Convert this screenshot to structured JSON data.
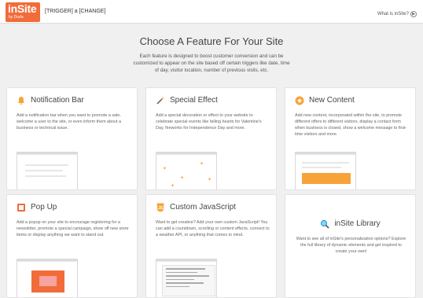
{
  "header": {
    "logo_text": "inSite",
    "logo_subtext": "by Duda",
    "trigger_text": "[TRIGGER] a [CHANGE]",
    "what_link": "What is inSite?"
  },
  "page": {
    "title": "Choose A Feature For Your Site",
    "intro": "Each feature is designed to boost customer conversion and can be customized to appear on the site based off certain triggers like date, time of day, visitor location, number of previous visits, etc."
  },
  "cards": [
    {
      "title": "Notification Bar",
      "icon": "bell-icon",
      "desc": "Add a notification bar when you want to promote a sale, welcome a user to the site, or even inform them about a business or technical issue."
    },
    {
      "title": "Special Effect",
      "icon": "magic-wand-icon",
      "desc": "Add a special decoration or effect to your website to celebrate special events like falling hearts for Valentine's Day, fireworks for Independence Day and more."
    },
    {
      "title": "New Content",
      "icon": "star-icon",
      "desc": "Add new content, incorporated within the site, to promote different offers to different visitors, display a contact form when business is closed, show a welcome message to first-time visitors and more."
    },
    {
      "title": "Pop Up",
      "icon": "popup-icon",
      "desc": "Add a popup on your site to encourage registering for a newsletter, promote a special campaign, show off new store items or display anything we want to stand out."
    },
    {
      "title": "Custom JavaScript",
      "icon": "javascript-icon",
      "desc": "Want to get creative? Add your own custom JavaScript! You can add a countdown, scrolling or content effects, connect to a weather API, or anything that comes to mind."
    },
    {
      "title": "inSite Library",
      "icon": "search-icon",
      "desc": "Want to see all of inSite's personalization options? Explore the full library of dynamic elements and get inspired to create your own!"
    }
  ],
  "colors": {
    "brand": "#f26b3a",
    "accent": "#f7a33a",
    "background": "#f0f0f0"
  }
}
